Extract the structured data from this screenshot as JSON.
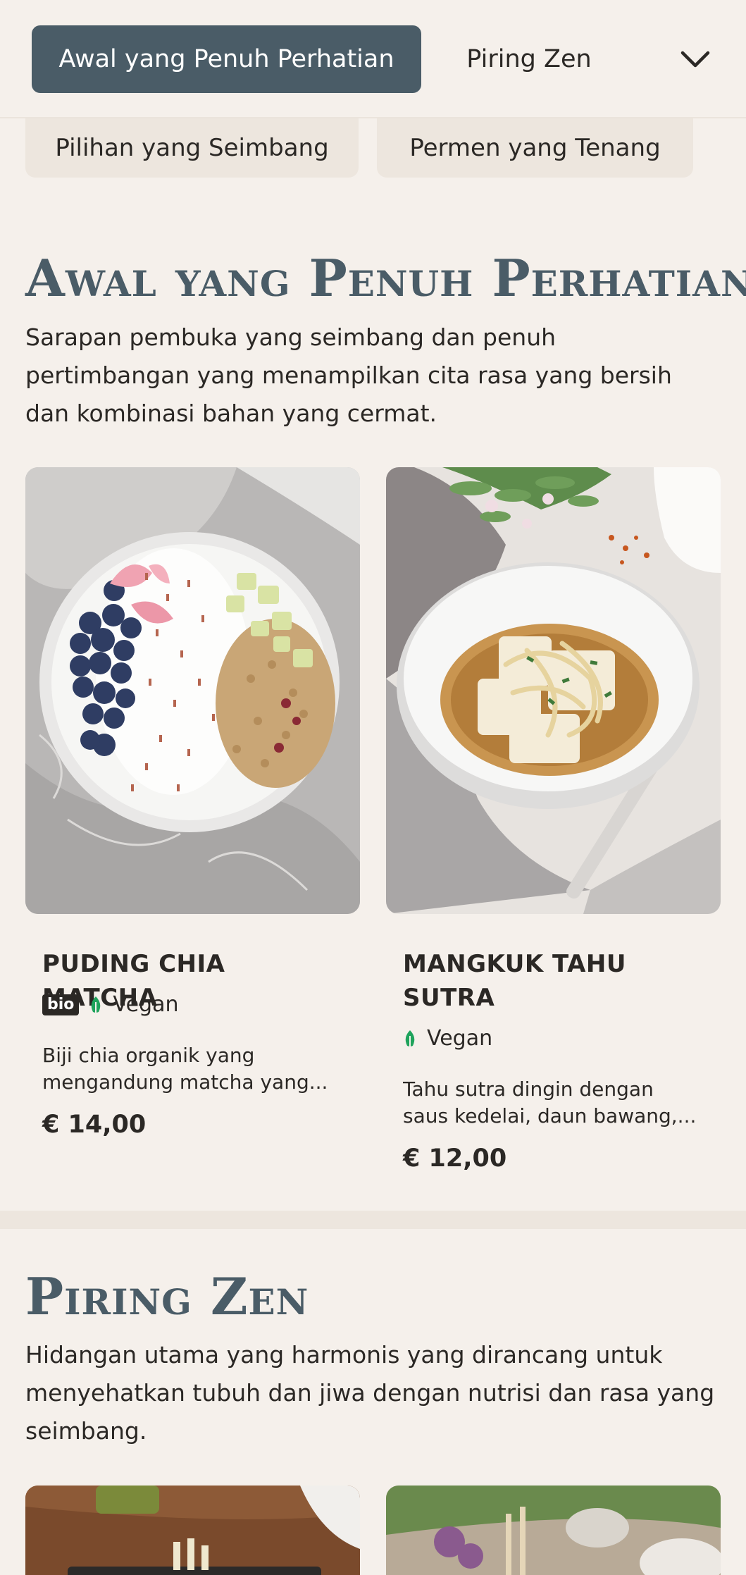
{
  "nav": {
    "active_tab": "Awal yang Penuh Perhatian",
    "next_tab": "Piring Zen",
    "dropdown_icon": "chevron-down-icon",
    "chips": [
      "Pilihan yang Seimbang",
      "Permen yang Tenang"
    ]
  },
  "sections": [
    {
      "title": "Awal yang Penuh Perhatian",
      "description": "Sarapan pembuka yang seimbang dan penuh pertimbangan yang menampilkan cita rasa yang bersih dan kombinasi bahan yang cermat.",
      "items": [
        {
          "name": "Puding Chia Matcha",
          "badge": "bio",
          "diet": "Vegan",
          "description": "Biji chia organik yang mengandung matcha yang...",
          "price": "€ 14,00"
        },
        {
          "name": "Mangkuk Tahu Sutra",
          "badge": "",
          "diet": "Vegan",
          "description": "Tahu sutra dingin dengan saus kedelai, daun bawang,...",
          "price": "€ 12,00"
        }
      ]
    },
    {
      "title": "Piring Zen",
      "description": "Hidangan utama yang harmonis yang dirancang untuk menyehatkan tubuh dan jiwa dengan nutrisi dan rasa yang seimbang."
    }
  ],
  "colors": {
    "background": "#f5f0eb",
    "accent": "#4a5c67",
    "vegan_leaf": "#1fa35c"
  }
}
